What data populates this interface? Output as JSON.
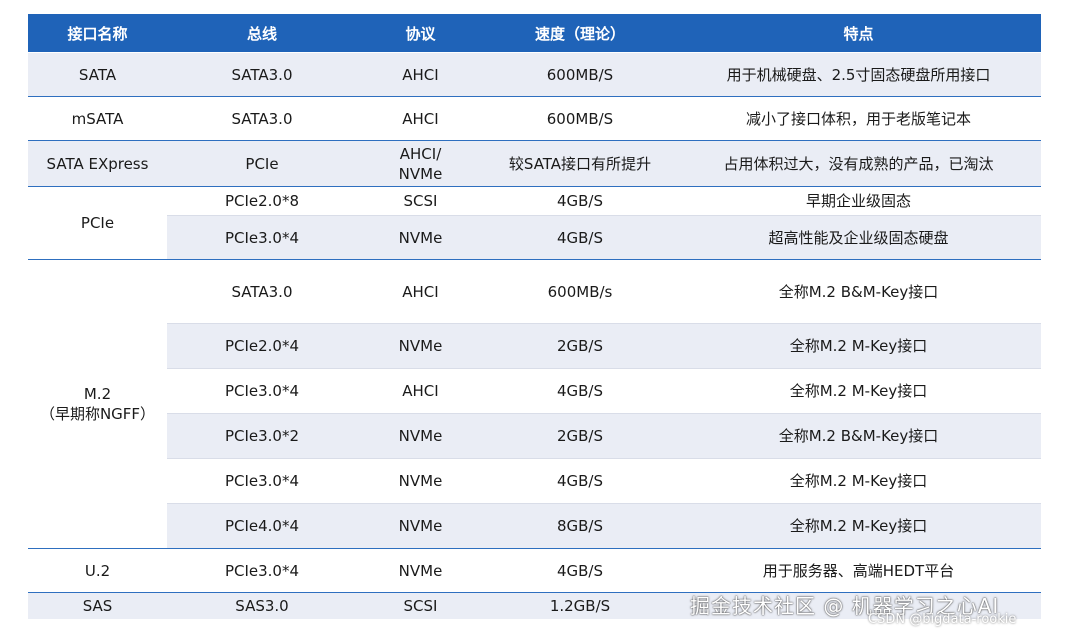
{
  "headers": [
    "接口名称",
    "总线",
    "协议",
    "速度（理论）",
    "特点"
  ],
  "rows": {
    "sata": {
      "name": "SATA",
      "bus": "SATA3.0",
      "protocol": "AHCI",
      "speed": "600MB/S",
      "feature": "用于机械硬盘、2.5寸固态硬盘所用接口"
    },
    "msata": {
      "name": "mSATA",
      "bus": "SATA3.0",
      "protocol": "AHCI",
      "speed": "600MB/S",
      "feature": "减小了接口体积，用于老版笔记本"
    },
    "sataexpress": {
      "name": "SATA EXpress",
      "bus": "PCIe",
      "protocol": "AHCI/\nNVMe",
      "speed": "较SATA接口有所提升",
      "feature": "占用体积过大，没有成熟的产品，已淘汰"
    },
    "pcie": {
      "name": "PCIe",
      "sub": [
        {
          "bus": "PCIe2.0*8",
          "protocol": "SCSI",
          "speed": "4GB/S",
          "feature": "早期企业级固态"
        },
        {
          "bus": "PCIe3.0*4",
          "protocol": "NVMe",
          "speed": "4GB/S",
          "feature": "超高性能及企业级固态硬盘"
        }
      ]
    },
    "m2": {
      "name": "M.2\n（早期称NGFF）",
      "sub": [
        {
          "bus": "SATA3.0",
          "protocol": "AHCI",
          "speed": "600MB/s",
          "feature": "全称M.2 B&M-Key接口"
        },
        {
          "bus": "PCIe2.0*4",
          "protocol": "NVMe",
          "speed": "2GB/S",
          "feature": "全称M.2 M-Key接口"
        },
        {
          "bus": "PCIe3.0*4",
          "protocol": "AHCI",
          "speed": "4GB/S",
          "feature": "全称M.2 M-Key接口"
        },
        {
          "bus": "PCIe3.0*2",
          "protocol": "NVMe",
          "speed": "2GB/S",
          "feature": "全称M.2 B&M-Key接口"
        },
        {
          "bus": "PCIe3.0*4",
          "protocol": "NVMe",
          "speed": "4GB/S",
          "feature": "全称M.2 M-Key接口"
        },
        {
          "bus": "PCIe4.0*4",
          "protocol": "NVMe",
          "speed": "8GB/S",
          "feature": "全称M.2 M-Key接口"
        }
      ]
    },
    "u2": {
      "name": "U.2",
      "bus": "PCIe3.0*4",
      "protocol": "NVMe",
      "speed": "4GB/S",
      "feature": "用于服务器、高端HEDT平台"
    },
    "sas": {
      "name": "SAS",
      "bus": "SAS3.0",
      "protocol": "SCSI",
      "speed": "1.2GB/S",
      "feature": ""
    }
  },
  "watermark": {
    "main": "掘金技术社区 @ 机器学习之心AI",
    "sub": "CSDN @bigdata-rookie"
  },
  "colors": {
    "header_bg": "#1f63b8",
    "row_shade": "#eaedf5",
    "rule": "#2e6fbf"
  }
}
